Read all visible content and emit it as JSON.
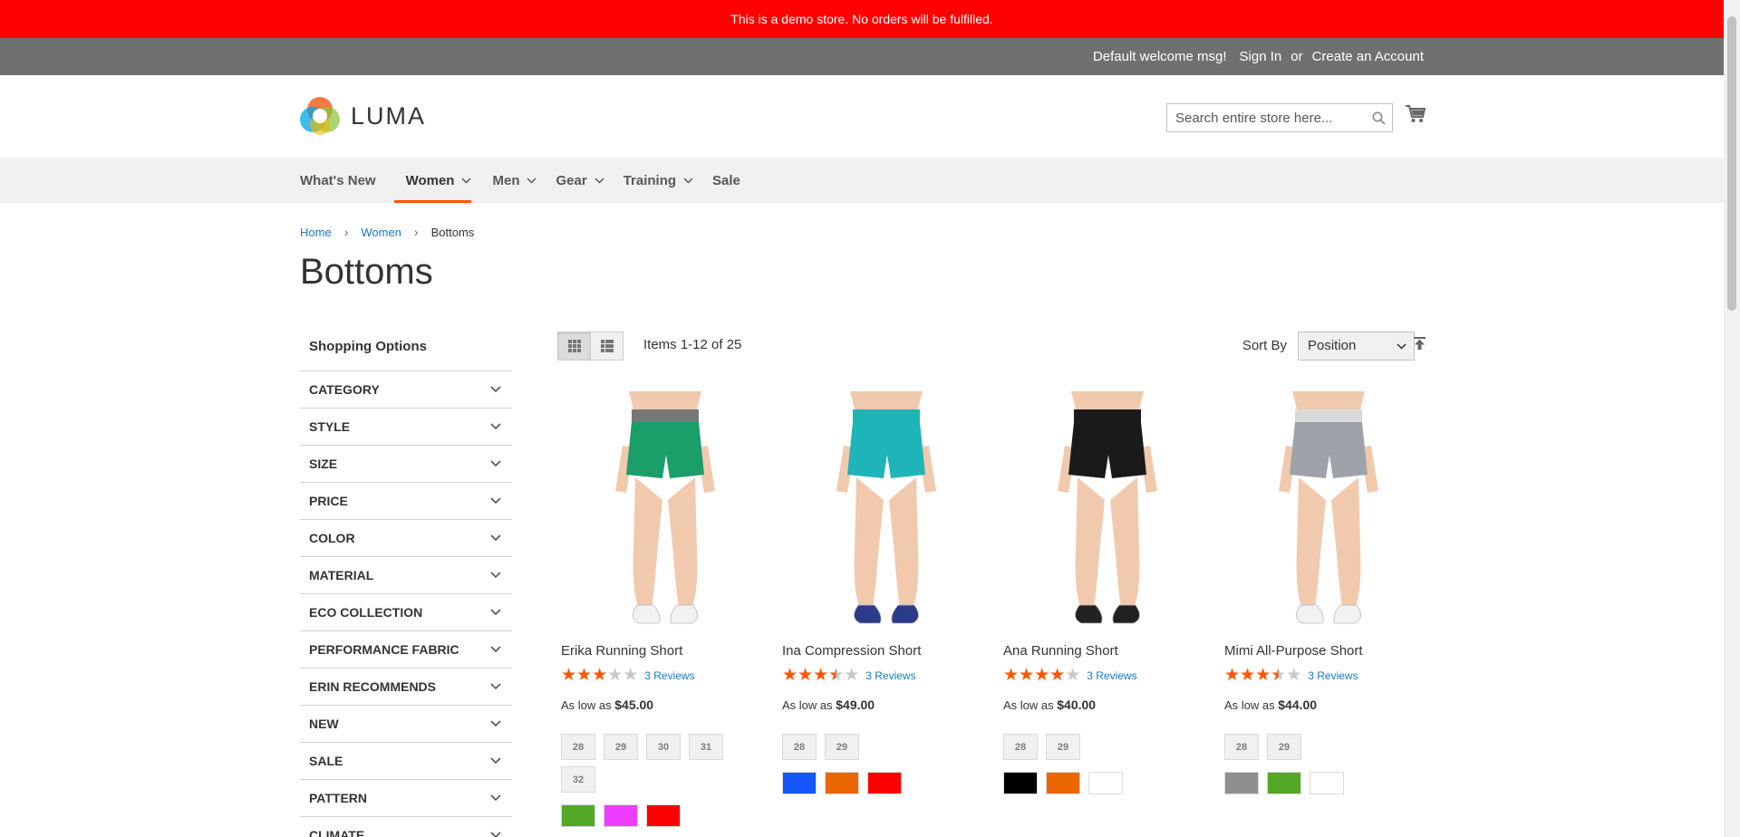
{
  "demo_notice": "This is a demo store. No orders will be fulfilled.",
  "header": {
    "welcome": "Default welcome msg!",
    "sign_in": "Sign In",
    "or": "or",
    "create_account": "Create an Account"
  },
  "logo": {
    "text": "LUMA"
  },
  "search": {
    "placeholder": "Search entire store here..."
  },
  "nav": {
    "items": [
      {
        "label": "What's New",
        "has_dropdown": false
      },
      {
        "label": "Women",
        "has_dropdown": true,
        "active": true
      },
      {
        "label": "Men",
        "has_dropdown": true
      },
      {
        "label": "Gear",
        "has_dropdown": true
      },
      {
        "label": "Training",
        "has_dropdown": true
      },
      {
        "label": "Sale",
        "has_dropdown": false
      }
    ]
  },
  "breadcrumbs": [
    "Home",
    "Women",
    "Bottoms"
  ],
  "page_title": "Bottoms",
  "sidebar": {
    "title": "Shopping Options",
    "filters": [
      "CATEGORY",
      "STYLE",
      "SIZE",
      "PRICE",
      "COLOR",
      "MATERIAL",
      "ECO COLLECTION",
      "PERFORMANCE FABRIC",
      "ERIN RECOMMENDS",
      "NEW",
      "SALE",
      "PATTERN",
      "CLIMATE"
    ]
  },
  "toolbar": {
    "amount": "Items 1-12 of 25",
    "sort_label": "Sort By",
    "sort_value": "Position",
    "view_mode": "grid"
  },
  "colors": {
    "accent": "#ff5501",
    "link": "#1979c3",
    "demo_bar": "#ff0000",
    "header_panel": "#6e716e"
  },
  "products": [
    {
      "name": "Erika Running Short",
      "rating": 3,
      "reviews": "3 Reviews",
      "price_prefix": "As low as",
      "price": "$45.00",
      "sizes": [
        "28",
        "29",
        "30",
        "31",
        "32"
      ],
      "swatches": [
        "#53a828",
        "#ef3dff",
        "#ff0000"
      ]
    },
    {
      "name": "Ina Compression Short",
      "rating": 3.5,
      "reviews": "3 Reviews",
      "price_prefix": "As low as",
      "price": "$49.00",
      "sizes": [
        "28",
        "29"
      ],
      "swatches": [
        "#1857f7",
        "#eb6703",
        "#ff0000"
      ]
    },
    {
      "name": "Ana Running Short",
      "rating": 4,
      "reviews": "3 Reviews",
      "price_prefix": "As low as",
      "price": "$40.00",
      "sizes": [
        "28",
        "29"
      ],
      "swatches": [
        "#000000",
        "#eb6703",
        "#ffffff"
      ]
    },
    {
      "name": "Mimi All-Purpose Short",
      "rating": 3.5,
      "reviews": "3 Reviews",
      "price_prefix": "As low as",
      "price": "$44.00",
      "sizes": [
        "28",
        "29"
      ],
      "swatches": [
        "#8f8f8f",
        "#53a828",
        "#ffffff"
      ]
    }
  ]
}
